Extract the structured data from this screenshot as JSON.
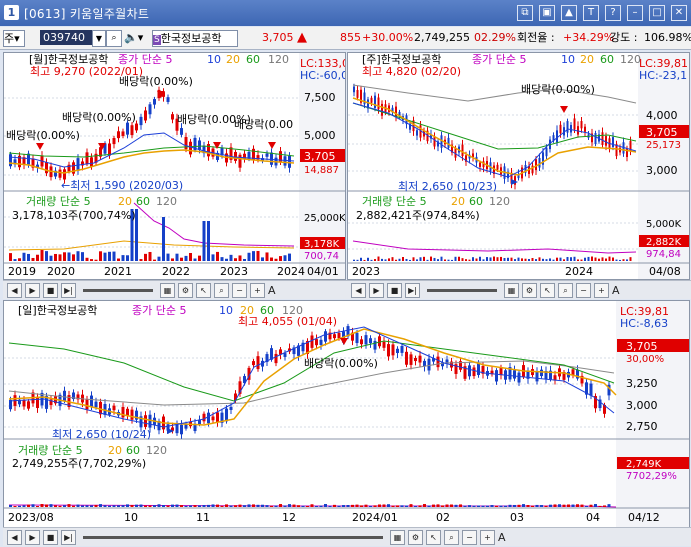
{
  "window": {
    "screen_no": "1",
    "title": "[0613] 키움일주월차트"
  },
  "toolbar": {
    "market": "주",
    "code": "039740",
    "stock_name": "한국정보공학",
    "price": "3,705",
    "change_arrow": "▲",
    "change": "855",
    "change_pct": "+30.00%",
    "volume": "2,749,255",
    "vol_ratio": "02.29%",
    "turnover_label": "회전율 :",
    "turnover": "+34.29%",
    "strength_label": "강도 :",
    "strength": "106.98%"
  },
  "colors": {
    "up": "#e00000",
    "down": "#1540c8",
    "ma5": "#c000c0",
    "ma10": "#1c3fd8",
    "ma20": "#e9a100",
    "ma60": "#1a9a1a",
    "ma120": "#8a8a8a"
  },
  "monthly": {
    "title": "[월]한국정보공학",
    "ma_header": "종가 단순 5",
    "ma_nums": [
      "10",
      "20",
      "60",
      "120"
    ],
    "high_label": "최고 9,270 (2022/01)",
    "low_label": "←최저 1,590 (2020/03)",
    "div_labels": [
      "배당락(0.00%)",
      "배당락(0.00%)",
      "배당락(0.00%)",
      "배당락(0.00%)",
      "배당락(0.00%)",
      "배당락(0.00"
    ],
    "lc": "LC:133,0",
    "hc": "HC:-60,0",
    "price_ticks": [
      "7,500",
      "5,000",
      "2,500"
    ],
    "cur_price": "3,705",
    "ma_val": "14,887",
    "vol_title": "거래량 단순 5",
    "vol_ma_nums": [
      "20",
      "60",
      "120"
    ],
    "vol_value": "3,178,103주(700,74%)",
    "vol_ticks": [
      "25,000K",
      "10,000K"
    ],
    "vol_cur": "3,178K",
    "vol_pct": "700,74",
    "x_labels": [
      "2019",
      "2020",
      "2021",
      "2022",
      "2023",
      "2024"
    ],
    "date_box": "04/01"
  },
  "weekly": {
    "title": "[주]한국정보공학",
    "ma_header": "종가 단순 5",
    "ma_nums": [
      "10",
      "20",
      "60",
      "120"
    ],
    "high_label": "최고 4,820 (02/20)",
    "low_label": "최저 2,650 (10/23)",
    "div_labels": [
      "배당락(0.00%)"
    ],
    "lc": "LC:39,81",
    "hc": "HC:-23,1",
    "price_ticks": [
      "4,000",
      "3,000"
    ],
    "cur_price": "3,705",
    "ma_val": "25,173",
    "vol_title": "거래량 단순 5",
    "vol_ma_nums": [
      "20",
      "60",
      "120"
    ],
    "vol_value": "2,882,421주(974,84%)",
    "vol_ticks": [
      "5,000K",
      "1,000K"
    ],
    "vol_cur": "2,882K",
    "vol_pct": "974,84",
    "x_labels": [
      "2023",
      "2024"
    ],
    "date_box": "04/08"
  },
  "daily": {
    "title": "[일]한국정보공학",
    "ma_header": "종가 단순 5",
    "ma_nums": [
      "10",
      "20",
      "60",
      "120"
    ],
    "high_label": "최고 4,055 (01/04)",
    "low_label": "최저 2,650 (10/24)",
    "div_labels": [
      "배당락(0.00%)"
    ],
    "lc": "LC:39,81",
    "hc": "HC:-8,63",
    "price_ticks": [
      "3,500",
      "3,250",
      "3,000",
      "2,750"
    ],
    "cur_price": "3,705",
    "cur_pct": "30,00%",
    "vol_title": "거래량 단순 5",
    "vol_ma_nums": [
      "20",
      "60",
      "120"
    ],
    "vol_value": "2,749,255주(7,702,29%)",
    "vol_cur": "2,749K",
    "vol_pct": "7702,29%",
    "x_labels": [
      "2023/08",
      "10",
      "11",
      "12",
      "2024/01",
      "02",
      "03",
      "04"
    ],
    "date_box": "04/12"
  },
  "nav_letter": "A"
}
